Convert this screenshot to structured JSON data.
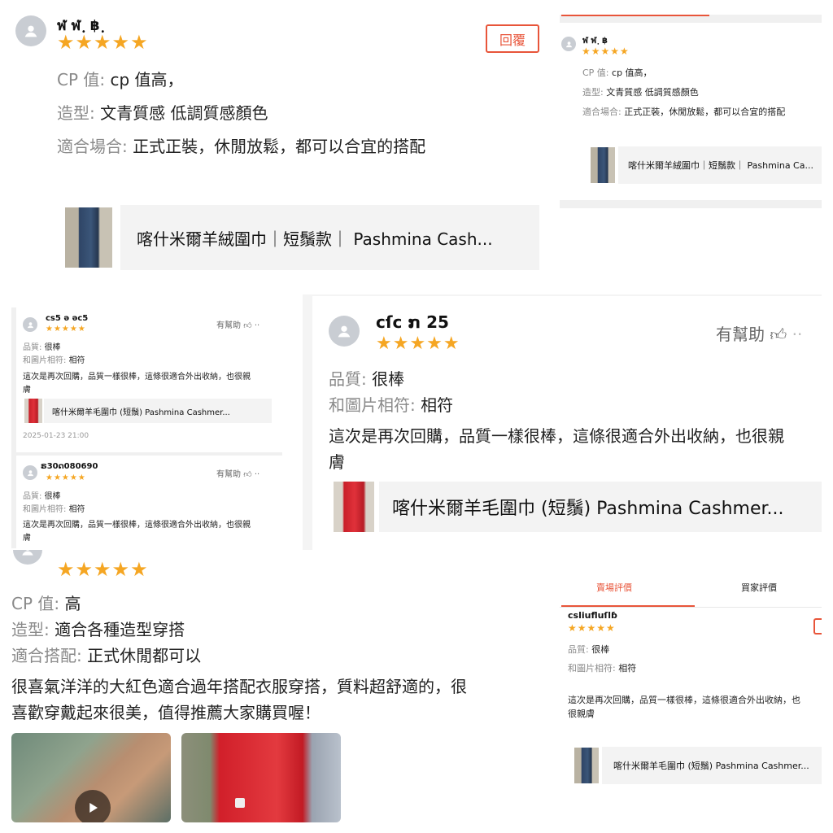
{
  "icons": {
    "avatar": "user-avatar-icon",
    "thumb_up": "thumb-up-icon",
    "more": "more-dots-icon",
    "play": "play-icon"
  },
  "colors": {
    "accent": "#e8553a",
    "star": "#f5a623",
    "key_text": "#8a8a8a"
  },
  "stars": "★★★★★",
  "panel1": {
    "username": "ฬ ฬ ฺ ฿ ฺ",
    "reply_label": "回覆",
    "lines": [
      {
        "key": "CP 值:",
        "value": "cp 值高，"
      },
      {
        "key": "造型:",
        "value": "文青質感 低調質感顏色"
      },
      {
        "key": "適合場合:",
        "value": "正式正裝，休閒放鬆，都可以合宜的搭配"
      }
    ],
    "product_title": "喀什米爾羊絨圍巾｜短鬚款｜ Pashmina Cash..."
  },
  "panel2": {
    "username": "ฬ ฬ ฺ ฿",
    "lines": [
      {
        "key": "CP 值:",
        "value": "cp 值高，"
      },
      {
        "key": "造型:",
        "value": "文青質感 低調質感顏色"
      },
      {
        "key": "適合場合:",
        "value": "正式正裝，休閒放鬆，都可以合宜的搭配"
      }
    ],
    "product_title": "喀什米爾羊絨圍巾｜短鬚款｜ Pashmina Ca..."
  },
  "panel3": {
    "review1": {
      "username": "cs5 ǝ ǝc5",
      "helpful": "有幫助",
      "lines": [
        {
          "key": "品質:",
          "value": "很棒"
        },
        {
          "key": "和圖片相符:",
          "value": "相符"
        }
      ],
      "body1": "這次是再次回購，品質一樣很棒，這條很適合外出收納，也很親",
      "body2": "膚",
      "product_title": "喀什米爾羊毛圍巾 (短鬚) Pashmina Cashmer...",
      "date": "2025-01-23 21:00"
    },
    "review2": {
      "username": "ຣ30ດ080690",
      "helpful": "有幫助",
      "lines": [
        {
          "key": "品質:",
          "value": "很棒"
        },
        {
          "key": "和圖片相符:",
          "value": "相符"
        }
      ],
      "body1": "這次是再次回購，品質一樣很棒，這條很適合外出收納，也很親",
      "body2": "膚"
    }
  },
  "panel4": {
    "username": "cſc ກ 25",
    "helpful": "有幫助",
    "lines": [
      {
        "key": "品質:",
        "value": "很棒"
      },
      {
        "key": "和圖片相符:",
        "value": "相符"
      }
    ],
    "body1": "這次是再次回購，品質一樣很棒，這條很適合外出收納，也很親",
    "body2": "膚",
    "product_title": "喀什米爾羊毛圍巾 (短鬚) Pashmina Cashmer..."
  },
  "panel5": {
    "lines": [
      {
        "key": "CP 值:",
        "value": "高"
      },
      {
        "key": "造型:",
        "value": "適合各種造型穿搭"
      },
      {
        "key": "適合搭配:",
        "value": "正式休閒都可以"
      }
    ],
    "body1": "很喜氣洋洋的大紅色適合過年搭配衣服穿搭，質料超舒適的，很",
    "body2": "喜歡穿戴起來很美，值得推薦大家購買喔！"
  },
  "panel6": {
    "tabs": [
      "賣場評價",
      "買家評價"
    ],
    "username": "csliufluſlɓ",
    "lines": [
      {
        "key": "品質:",
        "value": "很棒"
      },
      {
        "key": "和圖片相符:",
        "value": "相符"
      }
    ],
    "body1": "這次是再次回購，品質一樣很棒，這條很適合外出收納，也",
    "body2": "很親膚",
    "product_title": "喀什米爾羊毛圍巾 (短鬚) Pashmina Cashmer..."
  }
}
